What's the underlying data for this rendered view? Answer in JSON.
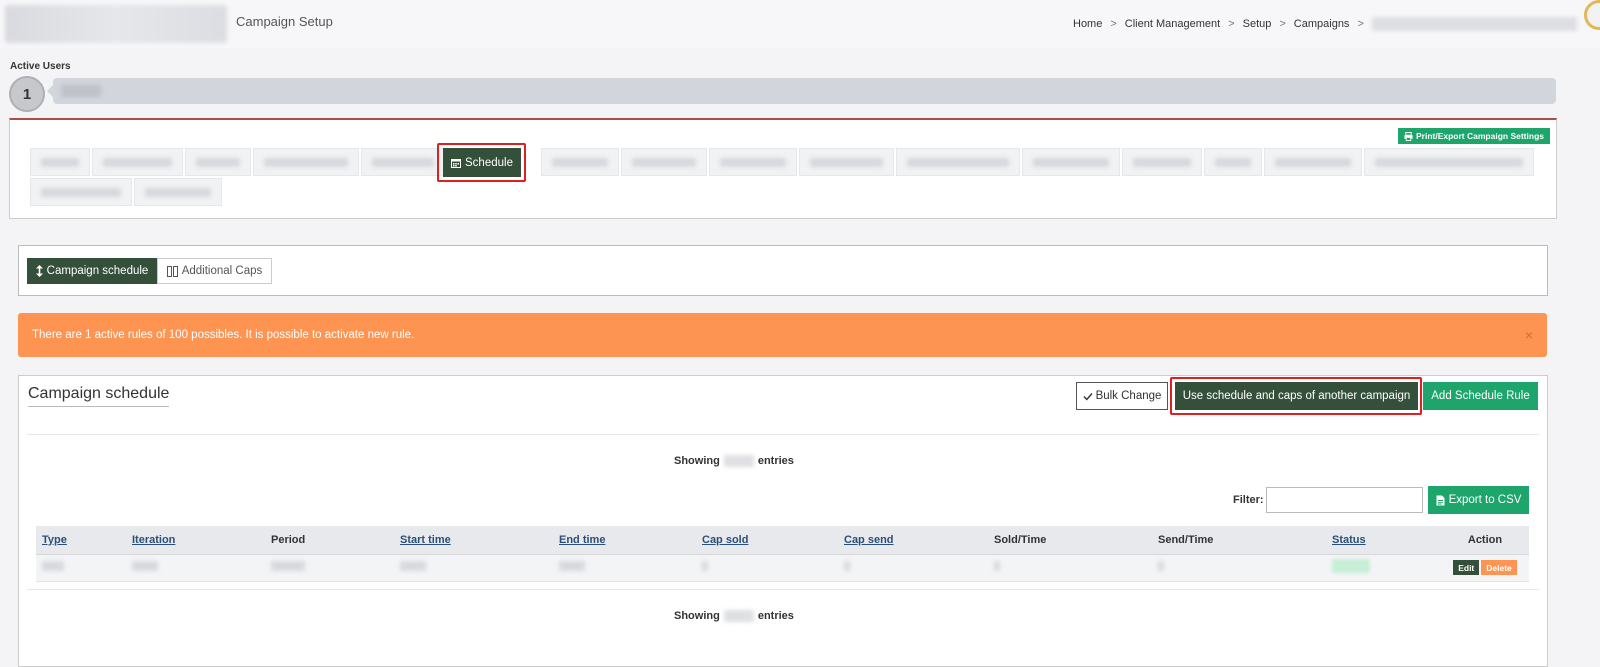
{
  "header": {
    "page_heading": "Campaign Setup",
    "breadcrumb": [
      "Home",
      "Client Management",
      "Setup",
      "Campaigns"
    ],
    "breadcrumb_separator": ">"
  },
  "active_users": {
    "label": "Active Users",
    "count": "1"
  },
  "nav": {
    "print_label": "Print/Export Campaign Settings",
    "active_tab_label": "Schedule"
  },
  "sub_tabs": {
    "campaign_schedule": "Campaign schedule",
    "additional_caps": "Additional Caps"
  },
  "alert": {
    "message": "There are 1 active rules of 100 possibles. It is possible to activate new rule.",
    "close_symbol": "×"
  },
  "schedule": {
    "title": "Campaign schedule",
    "bulk_change": "Bulk Change",
    "use_other": "Use schedule and caps of another campaign",
    "add_rule": "Add Schedule Rule",
    "showing_prefix": "Showing",
    "showing_suffix": "entries",
    "filter_label": "Filter:",
    "filter_value": "",
    "export_csv": "Export to CSV"
  },
  "table": {
    "columns": [
      "Type",
      "Iteration",
      "Period",
      "Start time",
      "End time",
      "Cap sold",
      "Cap send",
      "Sold/Time",
      "Send/Time",
      "Status",
      "Action"
    ],
    "row_actions": {
      "edit": "Edit",
      "delete": "Delete"
    }
  },
  "colors": {
    "dark_green": "#34503a",
    "accent_green": "#1ea56c",
    "alert_orange": "#fd9451",
    "highlight_red": "#e02020"
  },
  "icons": [
    "print-icon",
    "calendar-icon",
    "updown-arrow-icon",
    "columns-icon",
    "check-icon",
    "file-icon",
    "close-icon"
  ]
}
